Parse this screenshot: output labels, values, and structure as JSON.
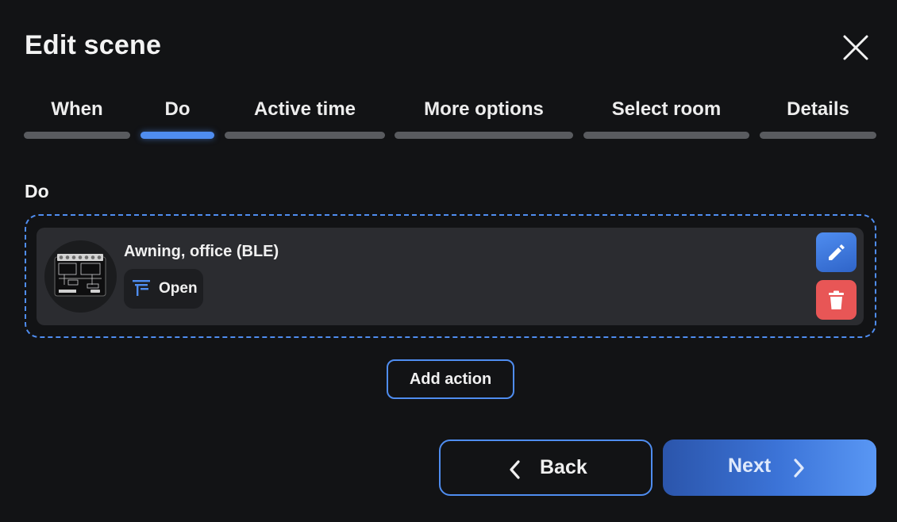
{
  "dialog": {
    "title": "Edit scene"
  },
  "tabs": [
    {
      "label": "When",
      "active": false
    },
    {
      "label": "Do",
      "active": true
    },
    {
      "label": "Active time",
      "active": false
    },
    {
      "label": "More options",
      "active": false
    },
    {
      "label": "Select room",
      "active": false
    },
    {
      "label": "Details",
      "active": false
    }
  ],
  "section": {
    "label": "Do"
  },
  "action": {
    "device_name": "Awning, office (BLE)",
    "device_icon": "shelly-device-image",
    "state_icon": "cover-open-icon",
    "state_label": "Open"
  },
  "buttons": {
    "add_action": "Add action",
    "back": "Back",
    "next": "Next"
  },
  "colors": {
    "background": "#121315",
    "accent": "#4f8df0",
    "card": "#2b2c30",
    "delete": "#e85656",
    "inactive_tab_bar": "#595b5f"
  }
}
